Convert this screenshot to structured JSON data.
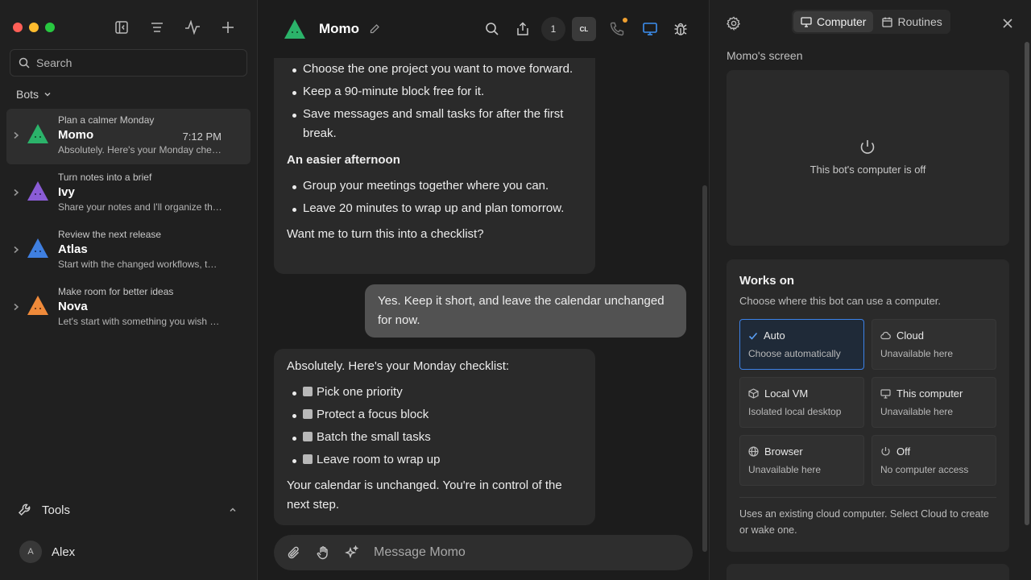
{
  "sidebar": {
    "search_placeholder": "Search",
    "bots_header": "Bots",
    "bots": [
      {
        "subtitle": "Plan a calmer Monday",
        "name": "Momo",
        "time": "7:12 PM",
        "preview": "Absolutely. Here's your Monday checklist:",
        "color": "#2bb36a"
      },
      {
        "subtitle": "Turn notes into a brief",
        "name": "Ivy",
        "time": "",
        "preview": "Share your notes and I'll organize them into a brief.",
        "color": "#8a5cd6"
      },
      {
        "subtitle": "Review the next release",
        "name": "Atlas",
        "time": "",
        "preview": "Start with the changed workflows, then the rest.",
        "color": "#3f7fe0"
      },
      {
        "subtitle": "Make room for better ideas",
        "name": "Nova",
        "time": "",
        "preview": "Let's start with something you wish you had time for.",
        "color": "#ef8a3a"
      }
    ],
    "tools_label": "Tools",
    "user": {
      "initial": "A",
      "name": "Alex"
    }
  },
  "chat": {
    "title": "Momo",
    "badge_count": "1",
    "cl_label": "CL",
    "message1": {
      "list_a": [
        "Choose the one project you want to move forward.",
        "Keep a 90-minute block free for it.",
        "Save messages and small tasks for after the first break."
      ],
      "heading": "An easier afternoon",
      "list_b": [
        "Group your meetings together where you can.",
        "Leave 20 minutes to wrap up and plan tomorrow."
      ],
      "closing": "Want me to turn this into a checklist?"
    },
    "user_message": "Yes. Keep it short, and leave the calendar unchanged for now.",
    "message2": {
      "intro": "Absolutely. Here's your Monday checklist:",
      "checklist": [
        "Pick one priority",
        "Protect a focus block",
        "Batch the small tasks",
        "Leave room to wrap up"
      ],
      "closing": "Your calendar is unchanged. You're in control of the next step."
    },
    "composer_placeholder": "Message Momo"
  },
  "panel": {
    "tabs": [
      "Computer",
      "Routines"
    ],
    "screen_label": "Momo's screen",
    "screen_status": "This bot's computer is off",
    "works_on": {
      "title": "Works on",
      "description": "Choose where this bot can use a computer.",
      "options": [
        {
          "title": "Auto",
          "subtitle": "Choose automatically",
          "icon": "check-icon"
        },
        {
          "title": "Cloud",
          "subtitle": "Unavailable here",
          "icon": "cloud-icon"
        },
        {
          "title": "Local VM",
          "subtitle": "Isolated local desktop",
          "icon": "cube-icon"
        },
        {
          "title": "This computer",
          "subtitle": "Unavailable here",
          "icon": "monitor-icon"
        },
        {
          "title": "Browser",
          "subtitle": "Unavailable here",
          "icon": "globe-icon"
        },
        {
          "title": "Off",
          "subtitle": "No computer access",
          "icon": "power-icon"
        }
      ],
      "note": "Uses an existing cloud computer. Select Cloud to create or wake one."
    }
  },
  "colors": {
    "accent": "#3c82e8",
    "notify_dot": "#f0a030"
  }
}
